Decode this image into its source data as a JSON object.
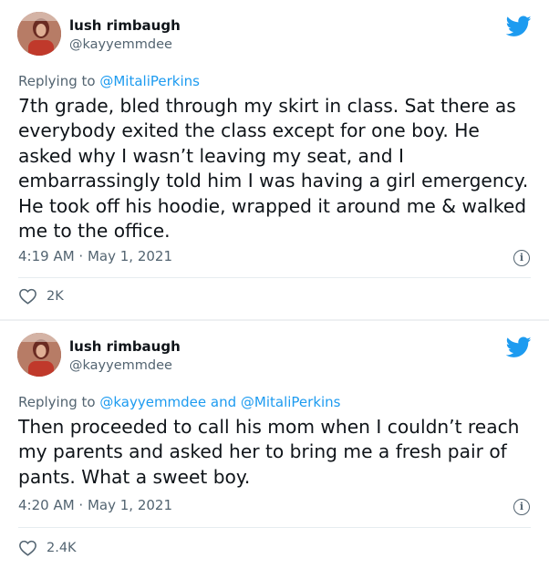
{
  "tweets": [
    {
      "author_name": "lush rimbaugh",
      "author_handle": "@kayyemmdee",
      "reply_prefix": "Replying to ",
      "reply_mentions": "@MitaliPerkins",
      "text": "7th grade, bled through my skirt in class. Sat there as everybody exited the class except for one boy. He asked why I wasn’t leaving my seat, and I embarrassingly told him I was having a girl emergency. He took off his hoodie, wrapped it around me & walked me to the office.",
      "timestamp": "4:19 AM · May 1, 2021",
      "likes": "2K"
    },
    {
      "author_name": "lush rimbaugh",
      "author_handle": "@kayyemmdee",
      "reply_prefix": "Replying to ",
      "reply_mentions": "@kayyemmdee and @MitaliPerkins",
      "text": "Then proceeded to call his mom when I couldn’t reach my parents and asked her to bring me a fresh pair of pants. What a sweet boy.",
      "timestamp": "4:20 AM · May 1, 2021",
      "likes": "2.4K"
    }
  ],
  "colors": {
    "twitter_blue": "#1d9bf0",
    "secondary_text": "#536471",
    "primary_text": "#0f1419"
  },
  "icons": {
    "brand": "twitter-bird-icon",
    "info": "info-icon",
    "like": "heart-icon"
  }
}
